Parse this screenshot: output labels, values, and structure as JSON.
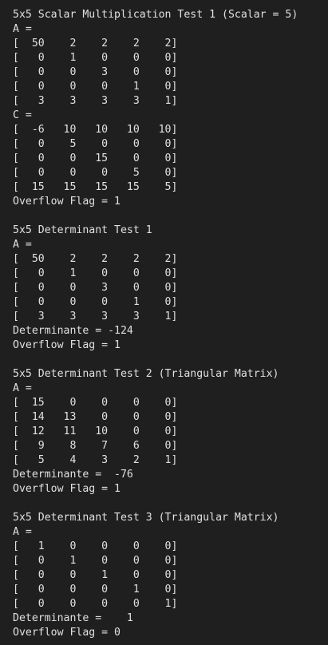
{
  "terminal": {
    "lines": [
      "5x5 Scalar Multiplication Test 1 (Scalar = 5)",
      "A =",
      "[  50    2    2    2    2]",
      "[   0    1    0    0    0]",
      "[   0    0    3    0    0]",
      "[   0    0    0    1    0]",
      "[   3    3    3    3    1]",
      "C =",
      "[  -6   10   10   10   10]",
      "[   0    5    0    0    0]",
      "[   0    0   15    0    0]",
      "[   0    0    0    5    0]",
      "[  15   15   15   15    5]",
      "Overflow Flag = 1",
      "",
      "5x5 Determinant Test 1",
      "A =",
      "[  50    2    2    2    2]",
      "[   0    1    0    0    0]",
      "[   0    0    3    0    0]",
      "[   0    0    0    1    0]",
      "[   3    3    3    3    1]",
      "Determinante = -124",
      "Overflow Flag = 1",
      "",
      "5x5 Determinant Test 2 (Triangular Matrix)",
      "A =",
      "[  15    0    0    0    0]",
      "[  14   13    0    0    0]",
      "[  12   11   10    0    0]",
      "[   9    8    7    6    0]",
      "[   5    4    3    2    1]",
      "Determinante =  -76",
      "Overflow Flag = 1",
      "",
      "5x5 Determinant Test 3 (Triangular Matrix)",
      "A =",
      "[   1    0    0    0    0]",
      "[   0    1    0    0    0]",
      "[   0    0    1    0    0]",
      "[   0    0    0    1    0]",
      "[   0    0    0    0    1]",
      "Determinante =    1",
      "Overflow Flag = 0"
    ]
  },
  "colors": {
    "background": "#1f1f1f",
    "text": "#e0e0e0"
  }
}
